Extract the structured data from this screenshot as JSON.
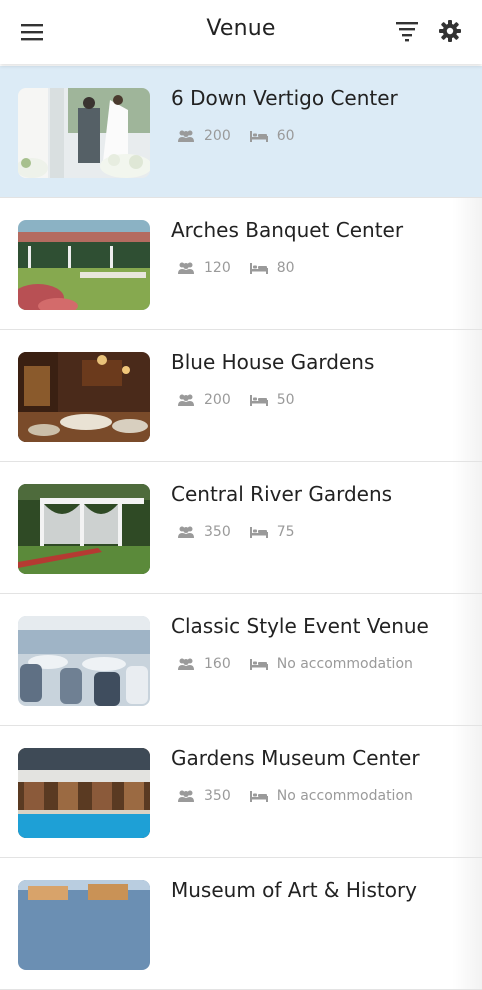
{
  "header": {
    "title": "Venue",
    "menu_icon": "hamburger-menu-icon",
    "filter_icon": "filter-icon",
    "settings_icon": "gear-icon"
  },
  "colors": {
    "selected_row": "#dcebf6",
    "text_primary": "#222222",
    "text_secondary": "#9a9a9a"
  },
  "venues": [
    {
      "name": "6 Down Vertigo Center",
      "guests": "200",
      "rooms": "60",
      "selected": true
    },
    {
      "name": "Arches Banquet Center",
      "guests": "120",
      "rooms": "80"
    },
    {
      "name": "Blue House Gardens",
      "guests": "200",
      "rooms": "50"
    },
    {
      "name": "Central River Gardens",
      "guests": "350",
      "rooms": "75"
    },
    {
      "name": "Classic Style Event Venue",
      "guests": "160",
      "rooms": "No accommodation"
    },
    {
      "name": "Gardens Museum Center",
      "guests": "350",
      "rooms": "No accommodation"
    },
    {
      "name": "Museum of Art & History",
      "guests": "",
      "rooms": ""
    }
  ]
}
